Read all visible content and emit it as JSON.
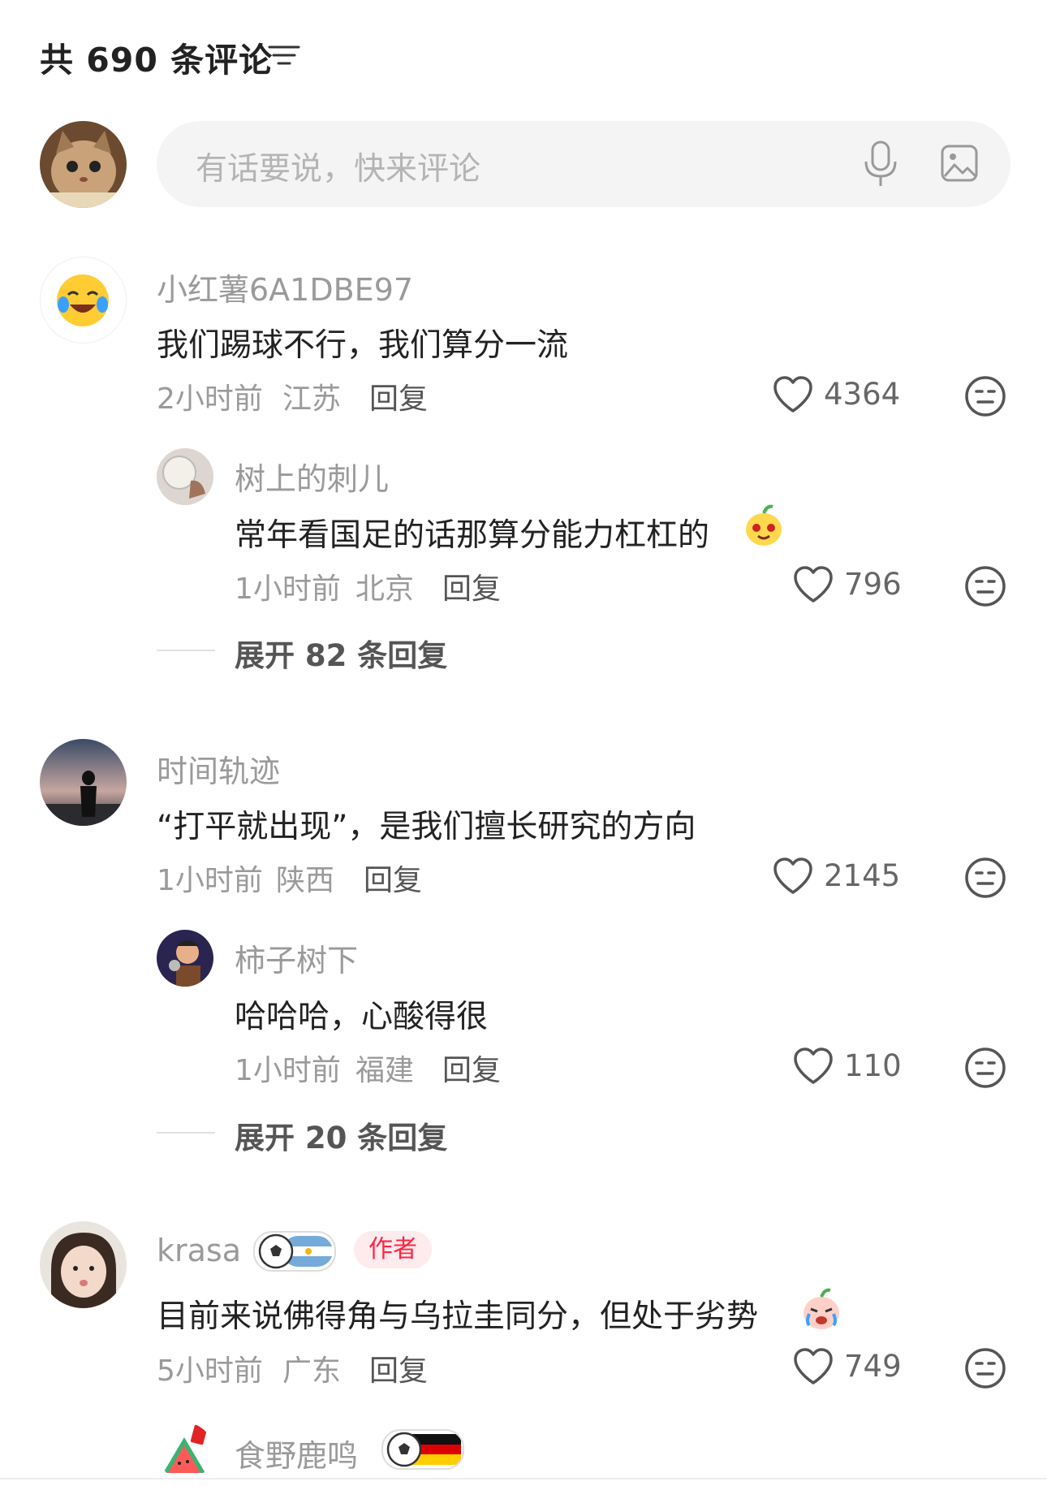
{
  "header": {
    "title": "共 690 条评论"
  },
  "input": {
    "placeholder": "有话要说，快来评论"
  },
  "comments": [
    {
      "name": "小红薯6A1DBE97",
      "text": "我们踢球不行，我们算分一流",
      "time": "2小时前",
      "location": "江苏",
      "reply": "回复",
      "likes": "4364"
    },
    {
      "name": "时间轨迹",
      "text": "“打平就出现”，是我们擅长研究的方向",
      "time": "1小时前",
      "location": "陕西",
      "reply": "回复",
      "likes": "2145"
    },
    {
      "name": "krasa",
      "badge": "作者",
      "text": "目前来说佛得角与乌拉圭同分，但处于劣势",
      "time": "5小时前",
      "location": "广东",
      "reply": "回复",
      "likes": "749"
    },
    {
      "name": "食野鹿鸣"
    }
  ],
  "replies": [
    {
      "name": "树上的刺儿",
      "text": "常年看国足的话那算分能力杠杠的",
      "time": "1小时前",
      "location": "北京",
      "reply": "回复",
      "likes": "796"
    },
    {
      "name": "柿子树下",
      "text": "哈哈哈，心酸得很",
      "time": "1小时前",
      "location": "福建",
      "reply": "回复",
      "likes": "110"
    }
  ],
  "expand": [
    "展开 82 条回复",
    "展开 20 条回复"
  ],
  "colors": {
    "accent": "#ff2442",
    "muted": "#9a9a9a",
    "input_bg": "#f4f4f4"
  }
}
